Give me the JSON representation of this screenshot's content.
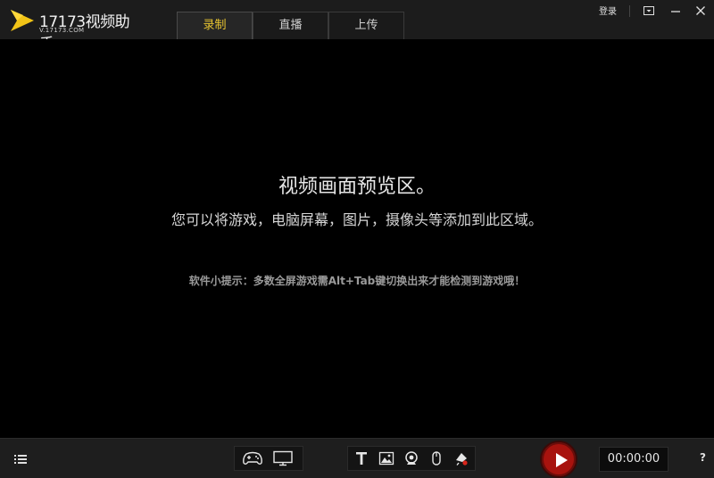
{
  "app": {
    "logo_title": "17173视频助手",
    "logo_sub": "V.17173.COM"
  },
  "tabs": [
    {
      "label": "录制",
      "active": true
    },
    {
      "label": "直播",
      "active": false
    },
    {
      "label": "上传",
      "active": false
    }
  ],
  "window": {
    "login_label": "登录"
  },
  "preview": {
    "title": "视频画面预览区。",
    "description": "您可以将游戏，电脑屏幕，图片，摄像头等添加到此区域。",
    "tip": "软件小提示：多数全屏游戏需Alt+Tab键切换出来才能检测到游戏哦！"
  },
  "bottom": {
    "timer": "00:00:00",
    "help": "?"
  },
  "icons": {
    "source_group": [
      "gamepad-icon",
      "monitor-icon"
    ],
    "overlay_group": [
      "text-icon",
      "image-icon",
      "webcam-icon",
      "mouse-icon",
      "red-dot-icon"
    ]
  },
  "colors": {
    "accent_yellow": "#e8c530",
    "record_red": "#a8130e",
    "background": "#000000"
  }
}
